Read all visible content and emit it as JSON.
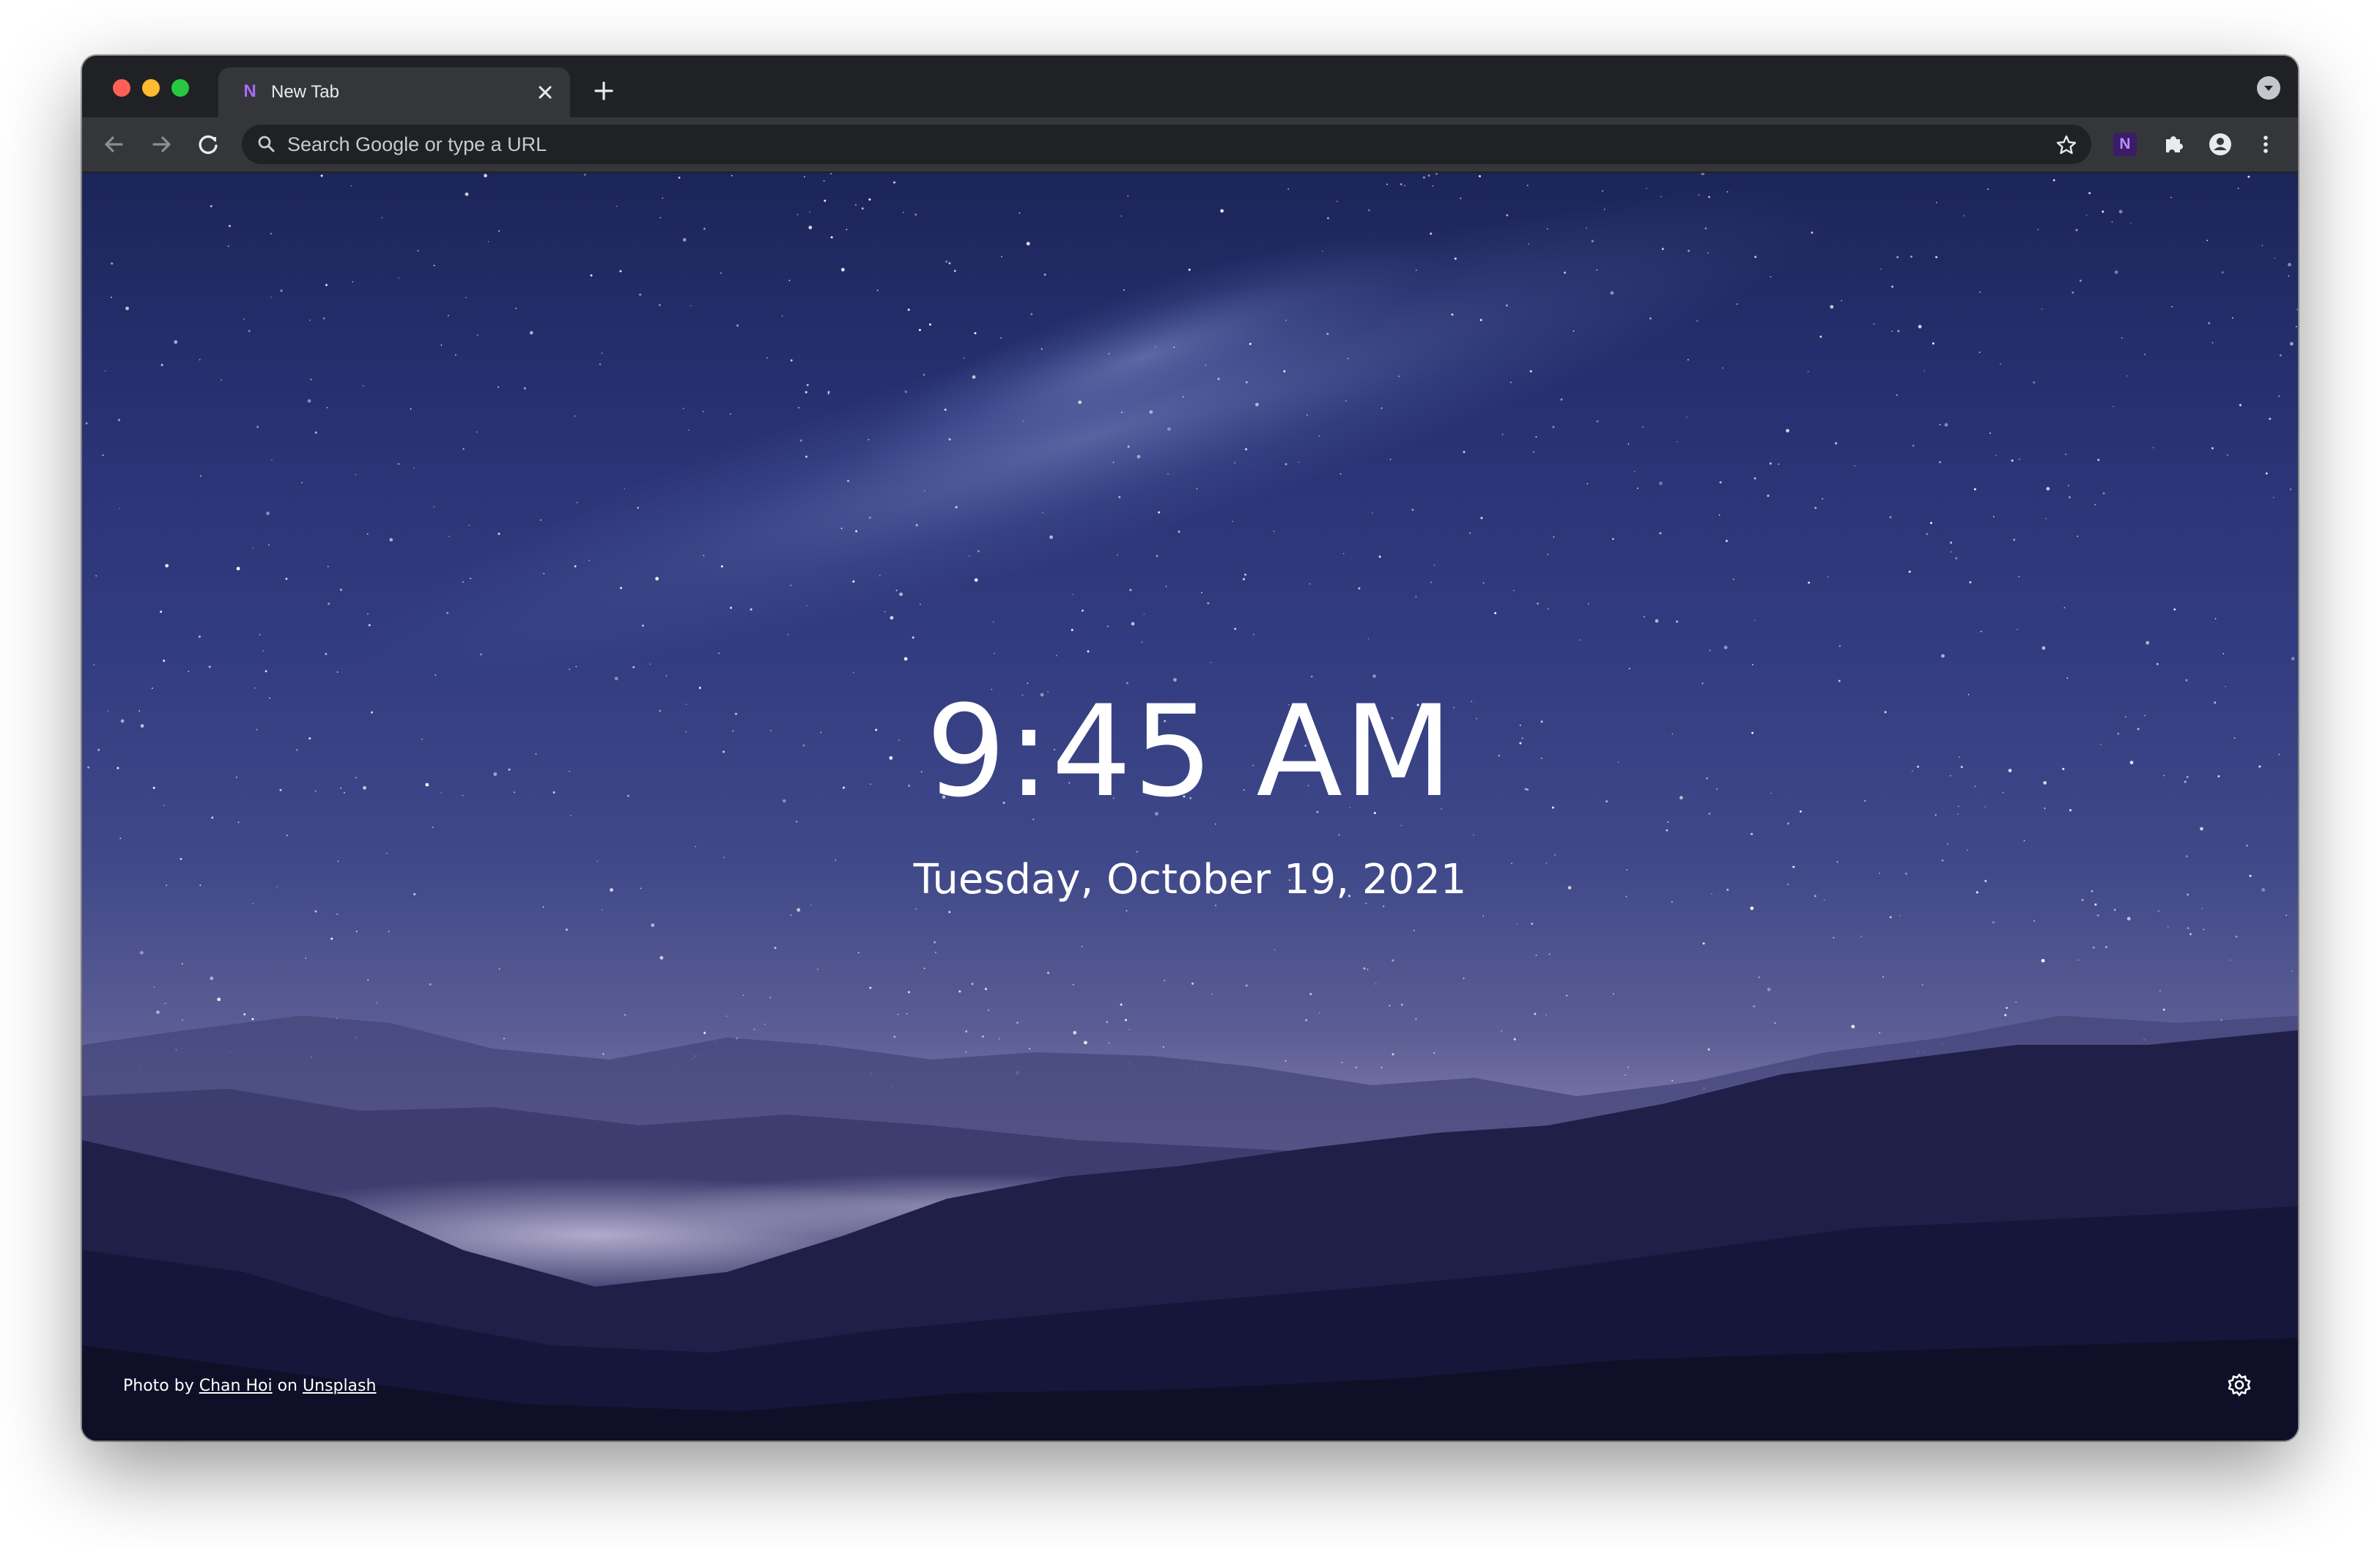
{
  "browser": {
    "tab": {
      "favicon_letter": "N",
      "title": "New Tab"
    },
    "omnibox": {
      "placeholder": "Search Google or type a URL"
    },
    "extension": {
      "letter": "N"
    },
    "icons": {
      "back": "arrow-left-icon",
      "forward": "arrow-right-icon",
      "reload": "reload-icon",
      "search": "search-icon",
      "star": "star-icon",
      "extensions": "puzzle-icon",
      "profile": "person-icon",
      "menu": "kebab-menu-icon",
      "close": "close-icon",
      "new_tab": "plus-icon",
      "tab_search": "chevron-down-icon"
    },
    "colors": {
      "traffic_red": "#fe5f57",
      "traffic_yellow": "#febc2e",
      "traffic_green": "#28c840",
      "extension_accent": "#a66cf6"
    }
  },
  "newtab": {
    "time": "9:45 AM",
    "date": "Tuesday, October 19, 2021",
    "credit": {
      "prefix": "Photo by ",
      "author": "Chan Hoi",
      "middle": " on ",
      "source": "Unsplash"
    },
    "settings_icon": "gear-icon"
  }
}
